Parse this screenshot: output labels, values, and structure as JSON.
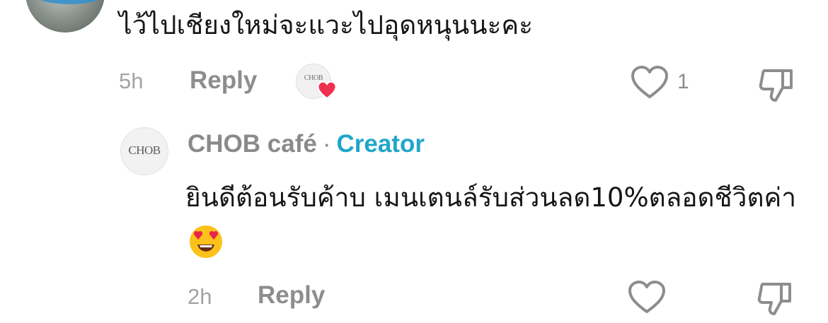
{
  "comment": {
    "text": "ไว้ไปเชียงใหม่จะแวะไปอุดหนุนนะคะ",
    "time": "5h",
    "reply_label": "Reply",
    "like_count": "1",
    "liked_by_avatar": {
      "logo_text": "CHOB"
    }
  },
  "reply": {
    "author": "CHOB café",
    "separator": "·",
    "badge": "Creator",
    "avatar_logo": "CHOB",
    "text": "ยินดีต้อนรับค้าบ เมนเตนล์รับส่วนลด10%ตลอดชีวิตค่า",
    "emoji_name": "heart-eyes-emoji",
    "time": "2h",
    "reply_label": "Reply"
  },
  "colors": {
    "meta_gray": "#8d8d8d",
    "creator_blue": "#20a6c9",
    "heart_red": "#f0304f"
  }
}
